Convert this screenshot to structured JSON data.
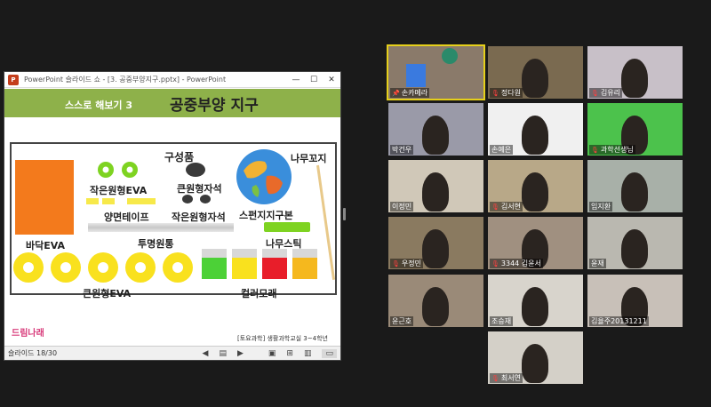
{
  "ppt": {
    "title": "PowerPoint 슬라이드 쇼 - [3. 공중부양지구.pptx] - PowerPoint",
    "logo": "P",
    "controls": {
      "minimize": "—",
      "maximize": "☐",
      "close": "✕"
    }
  },
  "slide": {
    "banner_left": "스스로 해보기 3",
    "banner_title": "공중부양 지구",
    "labels": {
      "components": "구성품",
      "small_eva": "작은원형EVA",
      "tape": "양면테이프",
      "big_magnet": "큰원형자석",
      "small_magnet": "작은원형자석",
      "globe": "스펀지지구본",
      "skewer": "나무꼬지",
      "floor_eva": "바닥EVA",
      "tube": "투명원통",
      "stick": "나무스틱",
      "big_eva": "큰원형EVA",
      "clay": "컬러모래"
    },
    "footer": "[토요과학] 생활과학교실 3~4학년",
    "brand": "드림나래"
  },
  "status": {
    "slide_counter": "슬라이드 18/30",
    "icons": [
      "prev-icon",
      "slide-menu-icon",
      "next-icon",
      "normal-view-icon",
      "sorter-view-icon",
      "reading-view-icon",
      "slideshow-icon"
    ]
  },
  "participants": [
    {
      "name": "손카메라",
      "muted": false,
      "pinned": true,
      "bg": "#8a7a6a"
    },
    {
      "name": "정다원",
      "muted": true,
      "bg": "#7a6a50"
    },
    {
      "name": "김유리",
      "muted": true,
      "bg": "#c8c0c8"
    },
    {
      "name": "박건우",
      "muted": false,
      "bg": "#9a9aa8"
    },
    {
      "name": "손예은",
      "muted": false,
      "bg": "#f0f0f0"
    },
    {
      "name": "과학선생님",
      "muted": true,
      "bg": "#4cc24c"
    },
    {
      "name": "이정민",
      "muted": false,
      "bg": "#d0c8b8"
    },
    {
      "name": "김서현",
      "muted": true,
      "bg": "#b8a888"
    },
    {
      "name": "임지환",
      "muted": false,
      "bg": "#a8b0a8"
    },
    {
      "name": "우정민",
      "muted": true,
      "bg": "#8a7a60"
    },
    {
      "name": "3344 김윤서",
      "muted": true,
      "bg": "#a09080"
    },
    {
      "name": "윤재",
      "muted": false,
      "bg": "#bab8b0"
    },
    {
      "name": "윤근호",
      "muted": false,
      "bg": "#9a8a78"
    },
    {
      "name": "조승재",
      "muted": false,
      "bg": "#d8d4cc"
    },
    {
      "name": "김율주20131211",
      "muted": false,
      "bg": "#c8c0b8"
    },
    {
      "name": "최서연",
      "muted": true,
      "bg": "#d4d0c8"
    }
  ]
}
